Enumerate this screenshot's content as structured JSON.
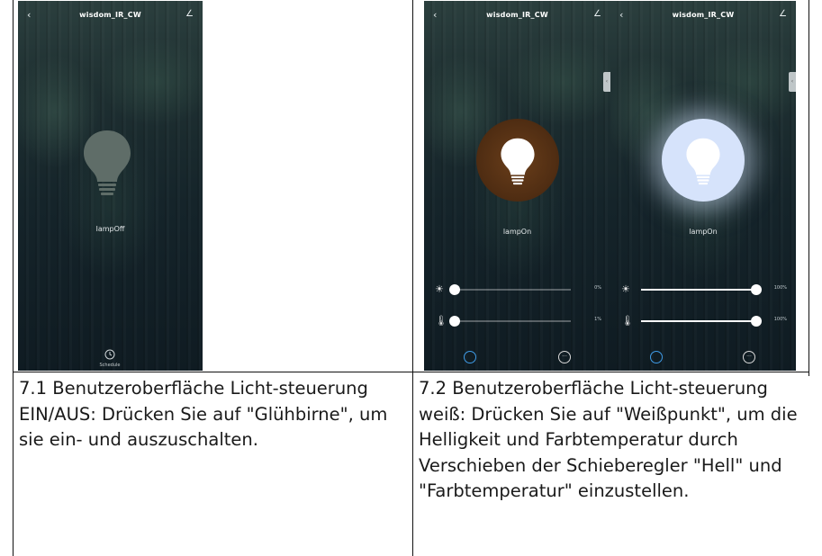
{
  "screens": [
    {
      "title": "wisdom_IR_CW",
      "lamp_label": "lampOff",
      "schedule_label": "Schedule"
    },
    {
      "title": "wisdom_IR_CW",
      "lamp_label": "lampOn",
      "sliders": [
        {
          "icon": "brightness-icon",
          "value_pct": 0,
          "label": "0%"
        },
        {
          "icon": "thermometer-icon",
          "value_pct": 0,
          "label": "1%"
        }
      ]
    },
    {
      "title": "wisdom_IR_CW",
      "lamp_label": "lampOn",
      "sliders": [
        {
          "icon": "brightness-icon",
          "value_pct": 100,
          "label": "100%"
        },
        {
          "icon": "thermometer-icon",
          "value_pct": 100,
          "label": "100%"
        }
      ]
    }
  ],
  "captions": [
    {
      "bold": "7.1 Benutzeroberfläche Licht-steuerung EIN/AUS:",
      "text": " Drücken Sie auf \"Glühbirne\", um sie ein- und auszuschalten."
    },
    {
      "bold": "7.2 Benutzeroberfläche Licht-steuerung weiß:",
      "text": " Drücken Sie auf \"Weißpunkt\", um die Helligkeit und Farbtemperatur durch Verschieben der Schieberegler \"Hell\" und \"Farbtemperatur\" einzustellen."
    }
  ],
  "colors": {
    "bulb_off_bg": "#4b5a56",
    "bulb_warm_bg": "#5a3517",
    "bulb_cool_bg": "#d6e3fb",
    "accent_blue": "#3f9be6"
  }
}
